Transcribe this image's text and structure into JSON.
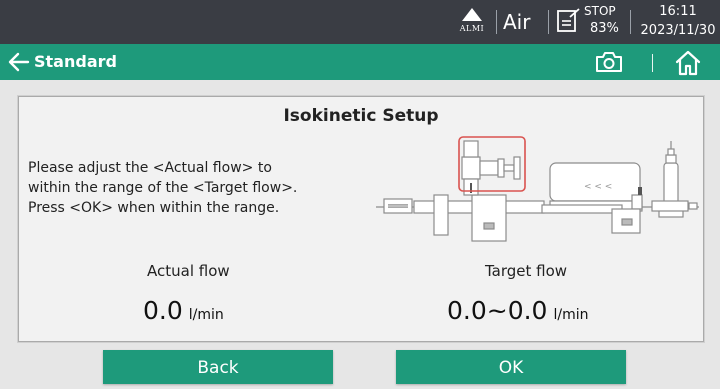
{
  "status": {
    "alarm_label": "ALMI",
    "gas": "Air",
    "state": "STOP",
    "battery": "83%",
    "time": "16:11",
    "date": "2023/11/30"
  },
  "nav": {
    "title": "Standard",
    "icons": [
      "back-arrow-icon",
      "camera-icon",
      "home-icon"
    ]
  },
  "panel": {
    "title": "Isokinetic Setup",
    "instructions": [
      "Please adjust the <Actual flow> to",
      "within the range of the <Target flow>.",
      "Press <OK> when within the range."
    ],
    "diagram_chevrons": "< < <",
    "actual": {
      "label": "Actual flow",
      "value": "0.0",
      "unit": "l/min"
    },
    "target": {
      "label": "Target flow",
      "value": "0.0~0.0",
      "unit": "l/min"
    }
  },
  "buttons": {
    "back": "Back",
    "ok": "OK"
  },
  "colors": {
    "accent": "#1e9a7b",
    "status_bar": "#3a3d44",
    "highlight": "#d9534f"
  }
}
